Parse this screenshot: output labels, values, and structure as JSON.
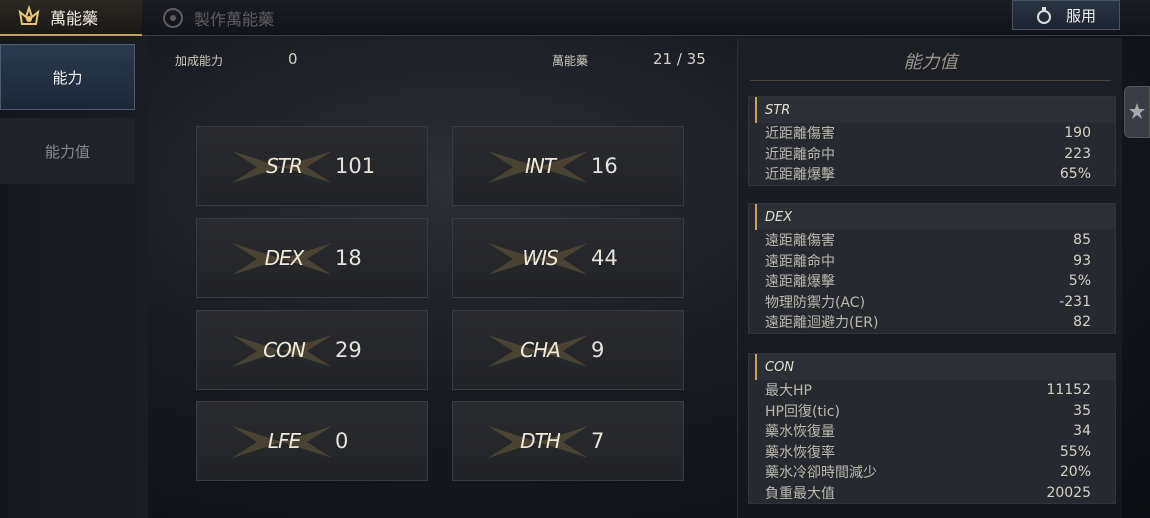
{
  "header": {
    "active_tab": "萬能藥",
    "inactive_tab": "製作萬能藥",
    "use_button": "服用"
  },
  "sidebar": {
    "items": [
      {
        "label": "能力"
      },
      {
        "label": "能力值"
      }
    ]
  },
  "info": {
    "bonus_label": "加成能力",
    "bonus_value": "0",
    "elixir_label": "萬能藥",
    "elixir_value": "21 / 35"
  },
  "stats": {
    "str": {
      "name": "STR",
      "value": "101"
    },
    "int": {
      "name": "INT",
      "value": "16"
    },
    "dex": {
      "name": "DEX",
      "value": "18"
    },
    "wis": {
      "name": "WIS",
      "value": "44"
    },
    "con": {
      "name": "CON",
      "value": "29"
    },
    "cha": {
      "name": "CHA",
      "value": "9"
    },
    "lfe": {
      "name": "LFE",
      "value": "0"
    },
    "dth": {
      "name": "DTH",
      "value": "7"
    }
  },
  "panel": {
    "title": "能力值",
    "str": {
      "head": "STR",
      "rows": [
        {
          "label": "近距離傷害",
          "value": "190"
        },
        {
          "label": "近距離命中",
          "value": "223"
        },
        {
          "label": "近距離爆擊",
          "value": "65%"
        }
      ]
    },
    "dex": {
      "head": "DEX",
      "rows": [
        {
          "label": "遠距離傷害",
          "value": "85"
        },
        {
          "label": "遠距離命中",
          "value": "93"
        },
        {
          "label": "遠距離爆擊",
          "value": "5%"
        },
        {
          "label": "物理防禦力(AC)",
          "value": "-231"
        },
        {
          "label": "遠距離迴避力(ER)",
          "value": "82"
        }
      ]
    },
    "con": {
      "head": "CON",
      "rows": [
        {
          "label": "最大HP",
          "value": "11152"
        },
        {
          "label": "HP回復(tic)",
          "value": "35"
        },
        {
          "label": "藥水恢復量",
          "value": "34"
        },
        {
          "label": "藥水恢復率",
          "value": "55%"
        },
        {
          "label": "藥水冷卻時間減少",
          "value": "20%"
        },
        {
          "label": "負重最大值",
          "value": "20025"
        }
      ]
    }
  },
  "colors": {
    "accent": "#c9a25a",
    "nav_active": "#2c3a50"
  }
}
